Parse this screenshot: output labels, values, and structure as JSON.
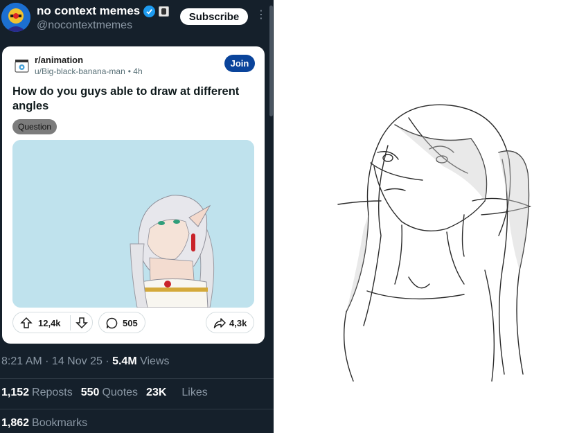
{
  "tweet": {
    "display_name": "no context memes",
    "handle": "@nocontextmemes",
    "subscribe_label": "Subscribe",
    "more_label": "⋮",
    "timestamp": "8:21 AM · 14 Nov 25 · ",
    "views_count": "5.4M",
    "views_label": "Views",
    "reposts_count": "1,152",
    "reposts_label": "Reposts",
    "quotes_count": "550",
    "quotes_label": "Quotes",
    "likes_count": "23K",
    "likes_label": "Likes",
    "bookmarks_count": "1,862",
    "bookmarks_label": "Bookmarks"
  },
  "reddit": {
    "subreddit": "r/animation",
    "user": "u/Big-black-banana-man",
    "age": "• 4h",
    "join_label": "Join",
    "title": "How do you guys able to draw at different angles",
    "flair": "Question",
    "upvotes": "12,4k",
    "comments": "505",
    "shares": "4,3k"
  },
  "icons": {
    "verified": "verified-check-icon",
    "affiliate": "affiliate-badge-icon",
    "upvote": "arrow-up-icon",
    "downvote": "arrow-down-icon",
    "comment": "comment-bubble-icon",
    "share": "share-arrow-icon"
  },
  "colors": {
    "tweet_background": "#15202b",
    "verified_blue": "#1d9bf0",
    "join_button": "#0a449b",
    "image_background": "#bfe2ed"
  }
}
